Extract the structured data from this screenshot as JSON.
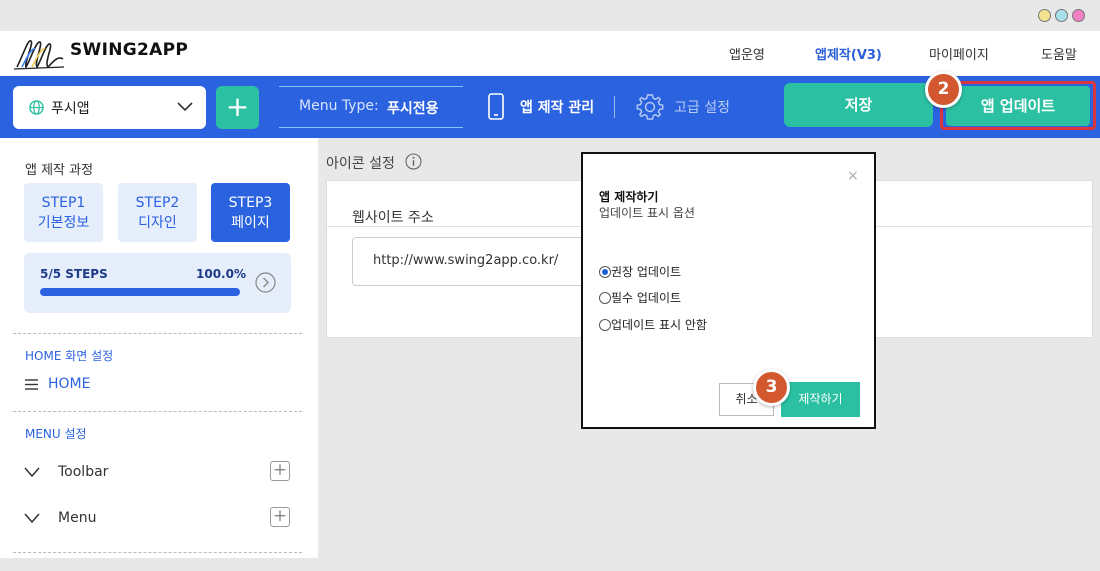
{
  "window": {
    "dots": [
      "#f5e28e",
      "#a8e0ea",
      "#f07fc4"
    ]
  },
  "header": {
    "brand": "SWING2APP",
    "nav": [
      "앱운영",
      "앱제작(V3)",
      "마이페이지",
      "도움말"
    ],
    "active_nav": "앱제작(V3)"
  },
  "toolbar": {
    "app_select": "푸시앱",
    "add_label": "+",
    "menu_type_label": "Menu Type:",
    "menu_type_value": "푸시전용",
    "manage_label": "앱 제작 관리",
    "advanced_label": "고급 설정",
    "save_label": "저장",
    "update_label": "앱 업데이트",
    "badge_update": "2"
  },
  "sidebar": {
    "title": "앱 제작 과정",
    "steps": [
      {
        "line1": "STEP1",
        "line2": "기본정보"
      },
      {
        "line1": "STEP2",
        "line2": "디자인"
      },
      {
        "line1": "STEP3",
        "line2": "페이지"
      }
    ],
    "progress_label": "5/5 STEPS",
    "progress_pct": "100.0%",
    "progress_value": 1.0,
    "home_section": "HOME 화면 설정",
    "home_item": "HOME",
    "menu_section": "MENU 설정",
    "menu_items": [
      "Toolbar",
      "Menu"
    ]
  },
  "main": {
    "section_title": "아이콘 설정",
    "field_label": "웹사이트 주소",
    "field_value": "http://www.swing2app.co.kr/"
  },
  "modal": {
    "close": "×",
    "title": "앱 제작하기",
    "subtitle": "업데이트 표시 옵션",
    "options": [
      "권장 업데이트",
      "필수 업데이트",
      "업데이트 표시 안함"
    ],
    "selected": 0,
    "cancel_label": "취소",
    "ok_label": "제작하기",
    "badge_ok": "3"
  },
  "colors": {
    "primary": "#2b62e0",
    "accent": "#2bc0a2",
    "badge": "#d3572f",
    "highlight": "#d9363e"
  }
}
